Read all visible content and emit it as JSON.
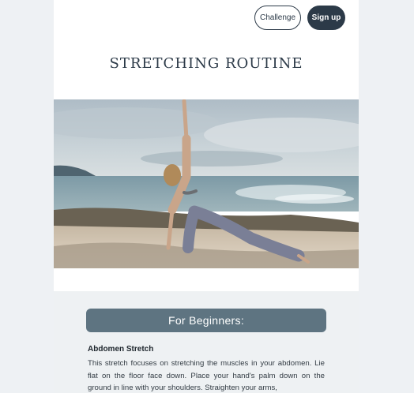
{
  "header": {
    "challenge_label": "Challenge",
    "signup_label": "Sign up"
  },
  "page_title": "STRETCHING ROUTINE",
  "hero_image": {
    "icon": "woman-yoga-stretch-beach-photo"
  },
  "section": {
    "header": "For Beginners:",
    "exercises": [
      {
        "name": "Abdomen Stretch",
        "description": "This stretch focuses on stretching the muscles in your abdomen. Lie flat on the floor face down. Place your hand's palm down on the ground in line with your shoulders. Straighten your arms,"
      }
    ]
  },
  "colors": {
    "dark_navy": "#2c3a48",
    "section_header_bg": "#5e7481",
    "content_bg": "#eef1f3"
  }
}
